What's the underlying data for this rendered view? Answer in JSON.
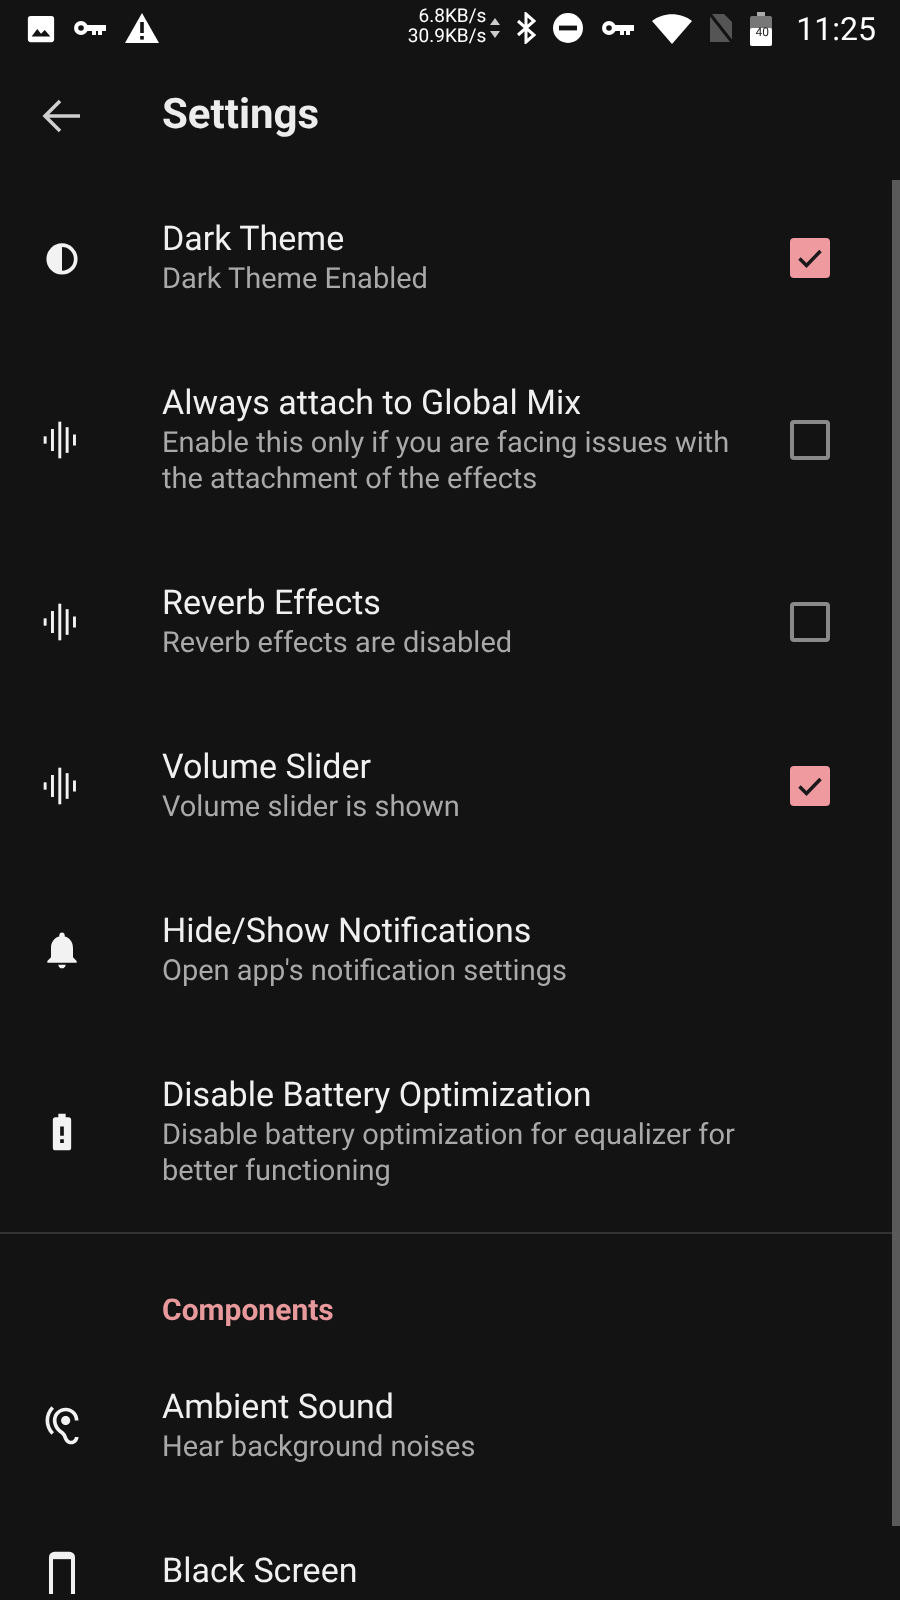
{
  "status_bar": {
    "net_up": "6.8KB/s",
    "net_down": "30.9KB/s",
    "battery": "40",
    "time": "11:25"
  },
  "app_bar": {
    "title": "Settings"
  },
  "settings": [
    {
      "kind": "checkbox",
      "title": "Dark Theme",
      "summary": "Dark Theme Enabled",
      "checked": true
    },
    {
      "kind": "checkbox",
      "title": "Always attach to Global Mix",
      "summary": "Enable this only if you are facing issues with the attachment of the effects",
      "checked": false
    },
    {
      "kind": "checkbox",
      "title": "Reverb Effects",
      "summary": "Reverb effects are disabled",
      "checked": false
    },
    {
      "kind": "checkbox",
      "title": "Volume Slider",
      "summary": "Volume slider is shown",
      "checked": true
    },
    {
      "kind": "plain",
      "title": "Hide/Show Notifications",
      "summary": "Open app's notification settings"
    },
    {
      "kind": "plain",
      "title": "Disable Battery Optimization",
      "summary": "Disable battery optimization for equalizer for better functioning"
    }
  ],
  "sections": [
    {
      "header": "Components",
      "items": [
        {
          "title": "Ambient Sound",
          "summary": "Hear background noises"
        },
        {
          "title": "Black Screen"
        }
      ]
    }
  ]
}
